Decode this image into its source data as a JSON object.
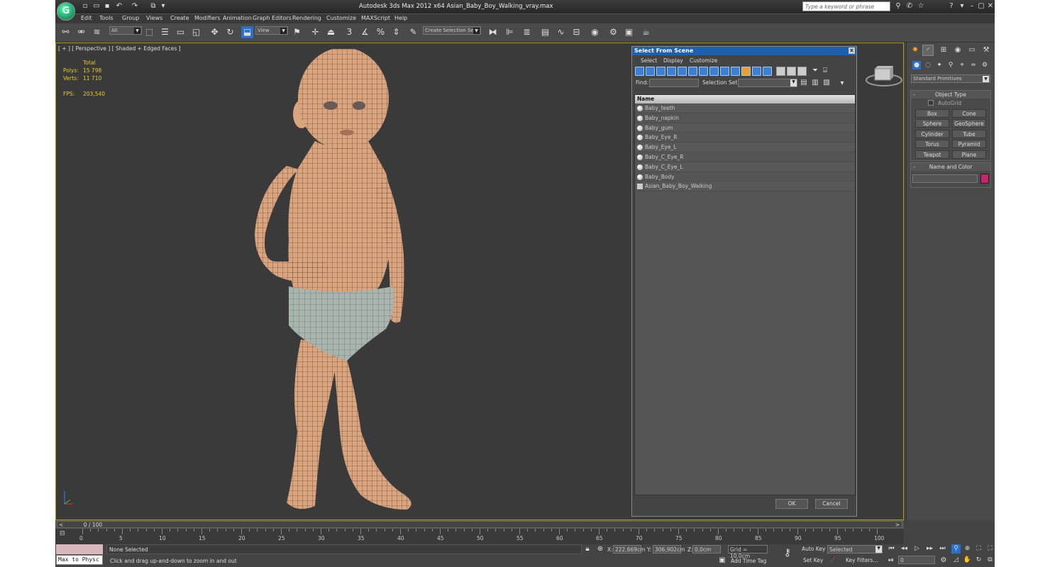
{
  "window": {
    "title": "Autodesk 3ds Max  2012 x64     Asian_Baby_Boy_Walking_vray.max",
    "logo_glyph": "G",
    "search_placeholder": "Type a keyword or phrase"
  },
  "menu": [
    "Edit",
    "Tools",
    "Group",
    "Views",
    "Create",
    "Modifiers",
    "Animation",
    "Graph Editors",
    "Rendering",
    "Customize",
    "MAXScript",
    "Help"
  ],
  "toolbar": {
    "filter_value": "All",
    "refcoord_value": "View",
    "selection_set_value": "Create Selection Se",
    "snap_3": "3"
  },
  "viewport": {
    "label": "[ + ] [ Perspective ] [ Shaded + Edged Faces ]",
    "stats": {
      "total_label": "Total",
      "polys_label": "Polys:",
      "polys_value": "15 798",
      "verts_label": "Verts:",
      "verts_value": "11 710",
      "fps_label": "FPS:",
      "fps_value": "203,540"
    }
  },
  "select_dialog": {
    "title": "Select From Scene",
    "close": "x",
    "menu": [
      "Select",
      "Display",
      "Customize"
    ],
    "find_label": "Find:",
    "selection_set_label": "Selection Set:",
    "column_name": "Name",
    "items": [
      {
        "name": "Baby_teeth",
        "type": "object"
      },
      {
        "name": "Baby_napkin",
        "type": "object"
      },
      {
        "name": "Baby_gum",
        "type": "object"
      },
      {
        "name": "Baby_Eye_R",
        "type": "object"
      },
      {
        "name": "Baby_Eye_L",
        "type": "object"
      },
      {
        "name": "Baby_C_Eye_R",
        "type": "object"
      },
      {
        "name": "Baby_C_Eye_L",
        "type": "object"
      },
      {
        "name": "Baby_Body",
        "type": "object"
      },
      {
        "name": "Asian_Baby_Boy_Walking",
        "type": "group"
      }
    ],
    "ok_label": "OK",
    "cancel_label": "Cancel"
  },
  "command_panel": {
    "category_value": "Standard Primitives",
    "object_type_header": "Object Type",
    "autogrid_label": "AutoGrid",
    "primitives": [
      "Box",
      "Cone",
      "Sphere",
      "GeoSphere",
      "Cylinder",
      "Tube",
      "Torus",
      "Pyramid",
      "Teapot",
      "Plane"
    ],
    "name_color_header": "Name and Color",
    "object_color": "#c8246e"
  },
  "timeline": {
    "slider_text": "0 / 100",
    "ticks": [
      "0",
      "5",
      "10",
      "15",
      "20",
      "25",
      "30",
      "35",
      "40",
      "45",
      "50",
      "55",
      "60",
      "65",
      "70",
      "75",
      "80",
      "85",
      "90",
      "95",
      "100"
    ]
  },
  "status": {
    "script_text": "Max to Physc",
    "selection_text": "None Selected",
    "prompt_text": "Click and drag up-and-down to zoom in and out",
    "x_label": "X:",
    "x_value": "222,669cm",
    "y_label": "Y:",
    "y_value": "306,902cm",
    "z_label": "Z:",
    "z_value": "0,0cm",
    "grid_text": "Grid = 10,0cm",
    "add_time_tag": "Add Time Tag",
    "auto_key": "Auto Key",
    "set_key": "Set Key",
    "selected_value": "Selected",
    "key_filters": "Key Filters...",
    "frame_value": "0"
  },
  "colors": {
    "viewport_border": "#b59a00",
    "stats_text": "#e8c830",
    "dialog_title": "#1e5fae",
    "skin": "#d9a47e",
    "diaper": "#a9b4ae"
  }
}
